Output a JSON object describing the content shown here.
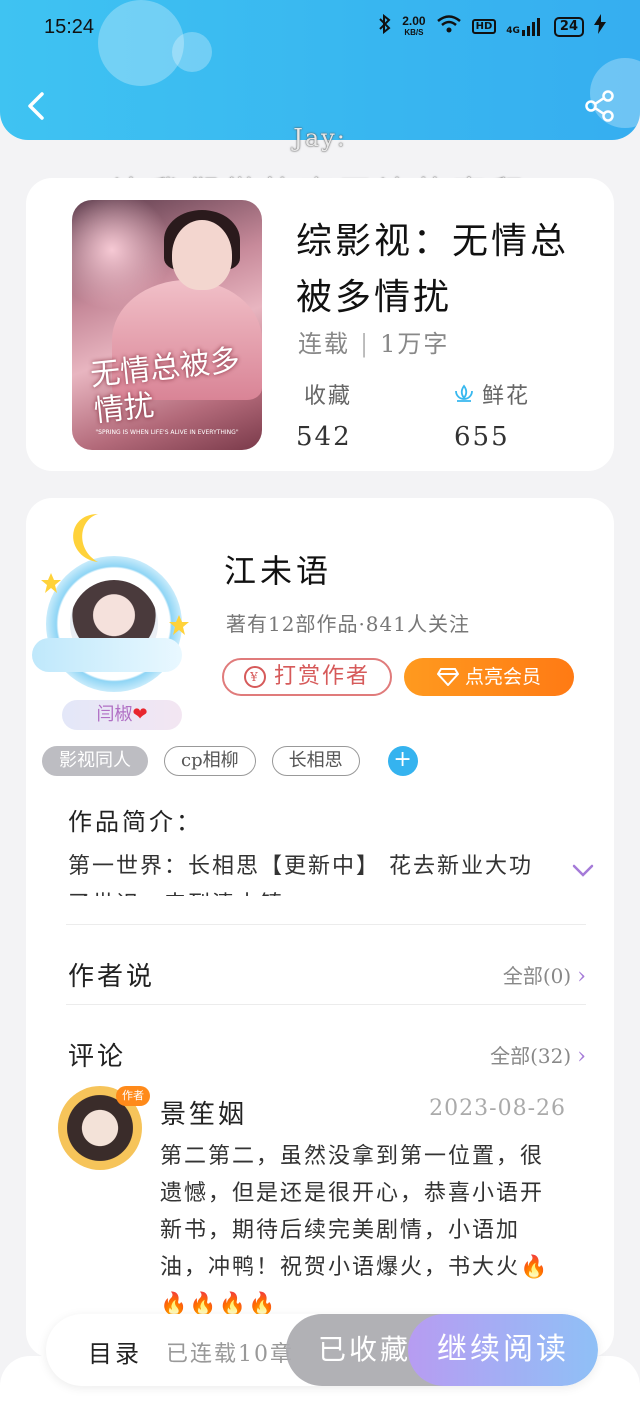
{
  "status_bar": {
    "time": "15:24",
    "net_speed_value": "2.00",
    "net_speed_unit": "KB/S",
    "hd": "HD",
    "signal": "4G",
    "battery": "24"
  },
  "watermark": {
    "line1": "Jay:",
    "line2": "让我们微笑离开让故事留"
  },
  "book": {
    "cover_title": "无情总被多情扰",
    "cover_tagline": "\"SPRING IS WHEN LIFE'S ALIVE IN EVERYTHING\"",
    "title": "综影视：无情总被多情扰",
    "status": "连载",
    "word_count": "1万字",
    "favorites_label": "收藏",
    "favorites_value": "542",
    "flowers_label": "鲜花",
    "flowers_value": "655"
  },
  "author": {
    "name": "江未语",
    "meta": "著有12部作品·841人关注",
    "pill_tag": "闫椒",
    "tip_label": "打赏作者",
    "tip_coin": "¥",
    "vip_label": "点亮会员"
  },
  "tags": [
    "影视同人",
    "cp相柳",
    "长相思"
  ],
  "intro": {
    "title": "作品简介：",
    "text": "第一世界：长相思【更新中】 花去新业大功了世识，来到清水镇"
  },
  "author_says": {
    "title": "作者说",
    "link": "全部(0)"
  },
  "comments": {
    "title": "评论",
    "link": "全部(32)",
    "items": [
      {
        "badge": "作者",
        "name": "景笙姻",
        "date": "2023-08-26",
        "text": "第二第二，虽然没拿到第一位置，很遗憾，但是还是很开心，恭喜小语开新书，期待后续完美剧情，小语加油，冲鸭！祝贺小语爆火，书大火🔥🔥🔥🔥🔥"
      }
    ]
  },
  "bottom_bar": {
    "toc_label": "目录",
    "toc_status": "已连载10章",
    "collected_label": "已收藏",
    "read_label": "继续阅读"
  },
  "colors": {
    "header": "#3fc3f2",
    "accent_orange": "#ff8a1a",
    "accent_purple": "#a57ad8",
    "tip_red": "#d65a5a",
    "plus_blue": "#35b3ef"
  }
}
